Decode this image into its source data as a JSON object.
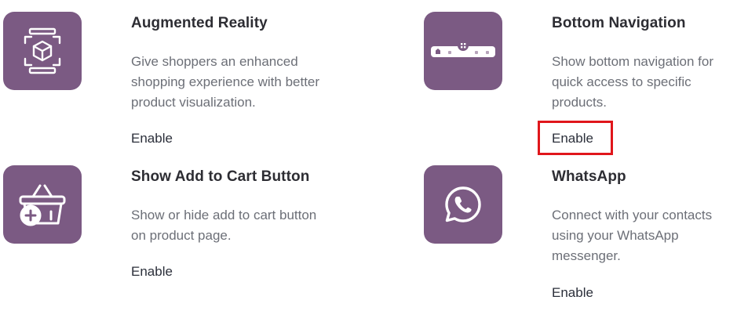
{
  "colors": {
    "tile": "#7b5a83",
    "title": "#2d2d33",
    "description": "#6c6f77",
    "enable": "#2b2f3a",
    "highlight": "#e0161b"
  },
  "features": [
    {
      "title": "Augmented Reality",
      "description_lines": [
        "Give shoppers an enhanced",
        "shopping experience with better",
        "product visualization."
      ],
      "enable_label": "Enable",
      "icon": "ar-cube-icon"
    },
    {
      "title": "Bottom Navigation",
      "description_lines": [
        "Show bottom navigation for",
        "quick access to specific",
        "products."
      ],
      "enable_label": "Enable",
      "icon": "bottom-navigation-icon",
      "enable_highlighted": true
    },
    {
      "title": "Show Add to Cart Button",
      "description_lines": [
        "Show or hide add to cart button",
        "on product page."
      ],
      "enable_label": "Enable",
      "icon": "add-to-cart-basket-icon"
    },
    {
      "title": "WhatsApp",
      "description_lines": [
        "Connect with your contacts",
        "using your WhatsApp",
        "messenger."
      ],
      "enable_label": "Enable",
      "icon": "whatsapp-icon"
    }
  ]
}
